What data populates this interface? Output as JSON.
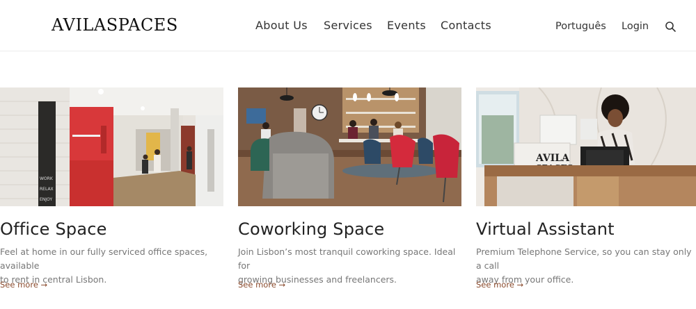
{
  "header": {
    "logo": "AVILASPACES",
    "nav": [
      "About Us",
      "Services",
      "Events",
      "Contacts"
    ],
    "language": "Português",
    "login": "Login",
    "search_icon": "search-icon"
  },
  "cards": [
    {
      "title": "Office Space",
      "description_line1": "Feel at home in our fully serviced office spaces, available",
      "description_line2": "to rent in central Lisbon.",
      "link": "See more →",
      "wall_sign": "WORK RELAX ENJOY"
    },
    {
      "title": "Coworking Space",
      "description_line1": "Join Lisbon’s most tranquil coworking space. Ideal for",
      "description_line2": "growing businesses and freelancers.",
      "link": "See more →"
    },
    {
      "title": "Virtual Assistant",
      "description_line1": "Premium Telephone Service, so you can stay only a call",
      "description_line2": "away from your office.",
      "link": "See more →",
      "desk_logo": "AVILA SPACES"
    }
  ],
  "colors": {
    "link": "#8a4a2c",
    "text": "#333333",
    "muted": "#777777"
  }
}
